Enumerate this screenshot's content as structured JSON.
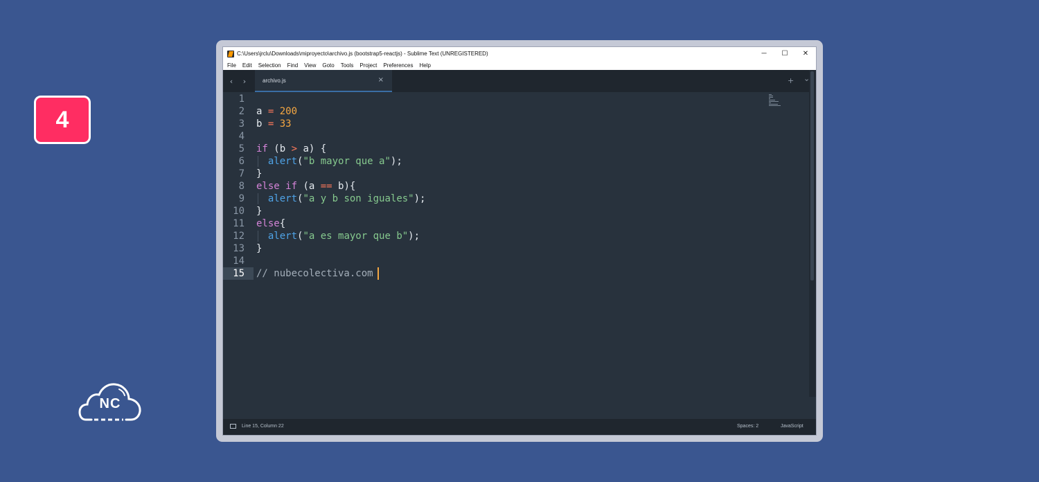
{
  "badge": {
    "label": "4"
  },
  "logo": {
    "text": "NC"
  },
  "window": {
    "title": "C:\\Users\\jrclu\\Downloads\\miproyecto\\archivo.js (bootstrap5-reactjs) - Sublime Text (UNREGISTERED)",
    "controls": {
      "minimize": "─",
      "maximize": "☐",
      "close": "✕"
    },
    "menu": [
      "File",
      "Edit",
      "Selection",
      "Find",
      "View",
      "Goto",
      "Tools",
      "Project",
      "Preferences",
      "Help"
    ]
  },
  "tabs": {
    "nav_back": "‹",
    "nav_forward": "›",
    "active_tab": {
      "label": "archivo.js",
      "close": "×"
    },
    "new_tab": "+",
    "tab_list": "⌄"
  },
  "editor": {
    "active_line": 15,
    "lines": [
      {
        "num": "1",
        "tokens": []
      },
      {
        "num": "2",
        "tokens": [
          {
            "t": "pl",
            "v": "a "
          },
          {
            "t": "op",
            "v": "="
          },
          {
            "t": "pl",
            "v": " "
          },
          {
            "t": "n",
            "v": "200"
          }
        ]
      },
      {
        "num": "3",
        "tokens": [
          {
            "t": "pl",
            "v": "b "
          },
          {
            "t": "op",
            "v": "="
          },
          {
            "t": "pl",
            "v": " "
          },
          {
            "t": "n",
            "v": "33"
          }
        ]
      },
      {
        "num": "4",
        "tokens": []
      },
      {
        "num": "5",
        "tokens": [
          {
            "t": "kw",
            "v": "if"
          },
          {
            "t": "pl",
            "v": " (b "
          },
          {
            "t": "op",
            "v": ">"
          },
          {
            "t": "pl",
            "v": " a) {"
          }
        ]
      },
      {
        "num": "6",
        "indent": true,
        "tokens": [
          {
            "t": "pl",
            "v": "  "
          },
          {
            "t": "fn",
            "v": "alert"
          },
          {
            "t": "pl",
            "v": "("
          },
          {
            "t": "st",
            "v": "\"b mayor que a\""
          },
          {
            "t": "pl",
            "v": ");"
          }
        ]
      },
      {
        "num": "7",
        "tokens": [
          {
            "t": "pl",
            "v": "}"
          }
        ]
      },
      {
        "num": "8",
        "tokens": [
          {
            "t": "kw",
            "v": "else"
          },
          {
            "t": "pl",
            "v": " "
          },
          {
            "t": "kw",
            "v": "if"
          },
          {
            "t": "pl",
            "v": " (a "
          },
          {
            "t": "op",
            "v": "=="
          },
          {
            "t": "pl",
            "v": " b){"
          }
        ]
      },
      {
        "num": "9",
        "indent": true,
        "tokens": [
          {
            "t": "pl",
            "v": "  "
          },
          {
            "t": "fn",
            "v": "alert"
          },
          {
            "t": "pl",
            "v": "("
          },
          {
            "t": "st",
            "v": "\"a y b son iguales\""
          },
          {
            "t": "pl",
            "v": ");"
          }
        ]
      },
      {
        "num": "10",
        "tokens": [
          {
            "t": "pl",
            "v": "}"
          }
        ]
      },
      {
        "num": "11",
        "tokens": [
          {
            "t": "kw",
            "v": "else"
          },
          {
            "t": "pl",
            "v": "{"
          }
        ]
      },
      {
        "num": "12",
        "indent": true,
        "tokens": [
          {
            "t": "pl",
            "v": "  "
          },
          {
            "t": "fn",
            "v": "alert"
          },
          {
            "t": "pl",
            "v": "("
          },
          {
            "t": "st",
            "v": "\"a es mayor que b\""
          },
          {
            "t": "pl",
            "v": ");"
          }
        ]
      },
      {
        "num": "13",
        "tokens": [
          {
            "t": "pl",
            "v": "}"
          }
        ]
      },
      {
        "num": "14",
        "tokens": []
      },
      {
        "num": "15",
        "cursor": true,
        "tokens": [
          {
            "t": "cm",
            "v": "// nubecolectiva.com"
          }
        ]
      }
    ]
  },
  "statusbar": {
    "position": "Line 15, Column 22",
    "spaces": "Spaces: 2",
    "syntax": "JavaScript"
  },
  "colors": {
    "background": "#3a5690",
    "badge": "#ff2d62",
    "editor_bg": "#28323d",
    "keyword": "#d484d8",
    "operator": "#ff7a5c",
    "number": "#f5a742",
    "function": "#4fa3e6",
    "string": "#86c98e",
    "comment": "#a3aeb9"
  }
}
